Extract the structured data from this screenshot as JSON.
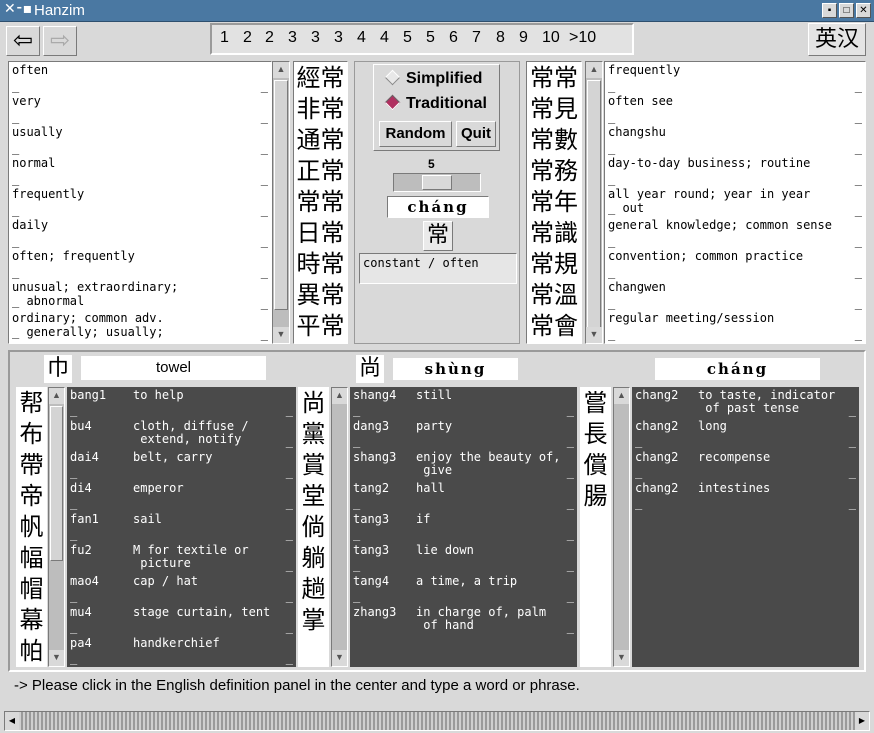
{
  "window": {
    "title": "Hanzim",
    "icon": "X-menu-icon"
  },
  "window_buttons": [
    "minimize",
    "maximize",
    "close"
  ],
  "nav": {
    "back_icon": "back-arrow-icon",
    "forward_icon": "forward-arrow-icon"
  },
  "frequency_tabs": [
    "1",
    "2",
    "2",
    "3",
    "3",
    "3",
    "4",
    "4",
    "5",
    "5",
    "6",
    "7",
    "8",
    "9",
    "10",
    ">10"
  ],
  "language_toggle": "英汉",
  "left_defs": [
    {
      "text": "often",
      "trail": ""
    },
    {
      "text": "very",
      "trail": ""
    },
    {
      "text": "usually",
      "trail": ""
    },
    {
      "text": "normal",
      "trail": ""
    },
    {
      "text": "frequently",
      "trail": ""
    },
    {
      "text": "daily",
      "trail": ""
    },
    {
      "text": "often; frequently",
      "trail": ""
    },
    {
      "text": "unusual; extraordinary;\n_ abnormal",
      "trail": ""
    },
    {
      "text": "ordinary; common adv.\n_ generally; usually;",
      "trail": ""
    }
  ],
  "left_words": [
    "經常",
    "非常",
    "通常",
    "正常",
    "常常",
    "日常",
    "時常",
    "異常",
    "平常"
  ],
  "mode": {
    "simplified": "Simplified",
    "traditional": "Traditional",
    "selected": "Traditional",
    "random": "Random",
    "quit": "Quit"
  },
  "slider": {
    "value": "5",
    "fraction": 0.5
  },
  "current": {
    "pinyin": "cháng",
    "char": "常",
    "definition": "constant / often"
  },
  "right_words": [
    "常常",
    "常見",
    "常數",
    "常務",
    "常年",
    "常識",
    "常規",
    "常溫",
    "常會"
  ],
  "right_defs": [
    {
      "text": "frequently",
      "trail": ""
    },
    {
      "text": "often see",
      "trail": ""
    },
    {
      "text": "changshu",
      "trail": ""
    },
    {
      "text": "day-to-day business; routine",
      "trail": ""
    },
    {
      "text": "all year round; year in year\n_ out",
      "trail": ""
    },
    {
      "text": "general knowledge; common sense",
      "trail": ""
    },
    {
      "text": "convention; common practice",
      "trail": ""
    },
    {
      "text": "changwen",
      "trail": ""
    },
    {
      "text": "regular meeting/session",
      "trail": ""
    }
  ],
  "radical_panel": {
    "radical": "巾",
    "meaning": "towel",
    "chars": [
      "帮",
      "布",
      "帶",
      "帝",
      "帆",
      "幅",
      "帽",
      "幕",
      "帕"
    ],
    "rows": [
      {
        "py": "bang1",
        "def": "to help"
      },
      {
        "py": "bu4",
        "def": "cloth, diffuse /\n extend, notify"
      },
      {
        "py": "dai4",
        "def": "belt, carry"
      },
      {
        "py": "di4",
        "def": "emperor"
      },
      {
        "py": "fan1",
        "def": "sail"
      },
      {
        "py": "fu2",
        "def": "M for textile or\n picture"
      },
      {
        "py": "mao4",
        "def": "cap / hat"
      },
      {
        "py": "mu4",
        "def": "stage curtain, tent"
      },
      {
        "py": "pa4",
        "def": "handkerchief"
      }
    ]
  },
  "phonetic_panel": {
    "component": "尚",
    "pinyin": "shùng",
    "chars": [
      "尚",
      "黨",
      "賞",
      "堂",
      "倘",
      "躺",
      "趟",
      "掌"
    ],
    "rows": [
      {
        "py": "shang4",
        "def": "still"
      },
      {
        "py": "dang3",
        "def": "party"
      },
      {
        "py": "shang3",
        "def": "enjoy the beauty of,\n give"
      },
      {
        "py": "tang2",
        "def": "hall"
      },
      {
        "py": "tang3",
        "def": "if"
      },
      {
        "py": "tang3",
        "def": "lie down"
      },
      {
        "py": "tang4",
        "def": "a time, a trip"
      },
      {
        "py": "zhang3",
        "def": "in charge of, palm\n of hand"
      }
    ]
  },
  "homophone_panel": {
    "pinyin": "cháng",
    "chars": [
      "嘗",
      "長",
      "償",
      "腸"
    ],
    "rows": [
      {
        "py": "chang2",
        "def": "to taste, indicator\n of past tense"
      },
      {
        "py": "chang2",
        "def": "long"
      },
      {
        "py": "chang2",
        "def": "recompense"
      },
      {
        "py": "chang2",
        "def": "intestines"
      }
    ]
  },
  "status": "-> Please click in the English definition panel in the center and type a word or phrase."
}
